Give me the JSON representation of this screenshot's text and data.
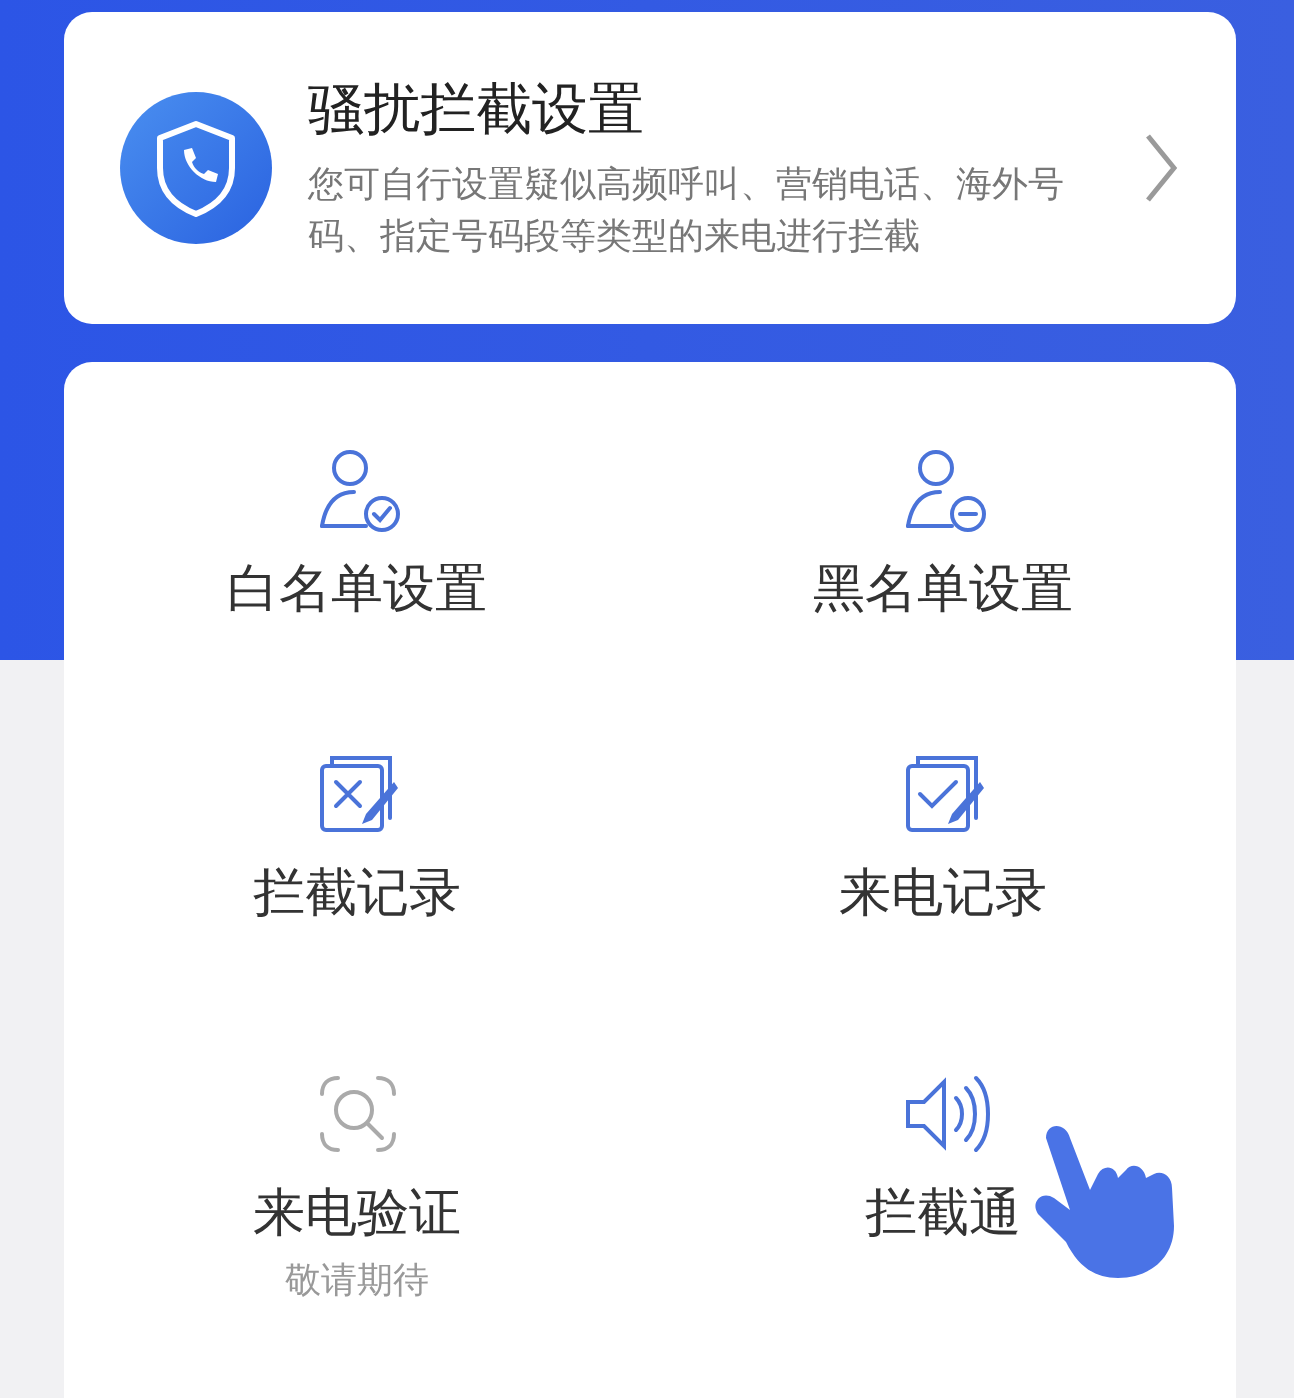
{
  "header_card": {
    "title": "骚扰拦截设置",
    "description": "您可自行设置疑似高频呼叫、营销电话、海外号码、指定号码段等类型的来电进行拦截"
  },
  "features": [
    {
      "kind": "whitelist",
      "label": "白名单设置",
      "disabled": false
    },
    {
      "kind": "blacklist",
      "label": "黑名单设置",
      "disabled": false
    },
    {
      "kind": "blocked_log",
      "label": "拦截记录",
      "disabled": false
    },
    {
      "kind": "call_log",
      "label": "来电记录",
      "disabled": false
    },
    {
      "kind": "verify",
      "label": "来电验证",
      "subtitle": "敬请期待",
      "disabled": true
    },
    {
      "kind": "notify",
      "label": "拦截通",
      "disabled": false,
      "pointer": true
    }
  ]
}
